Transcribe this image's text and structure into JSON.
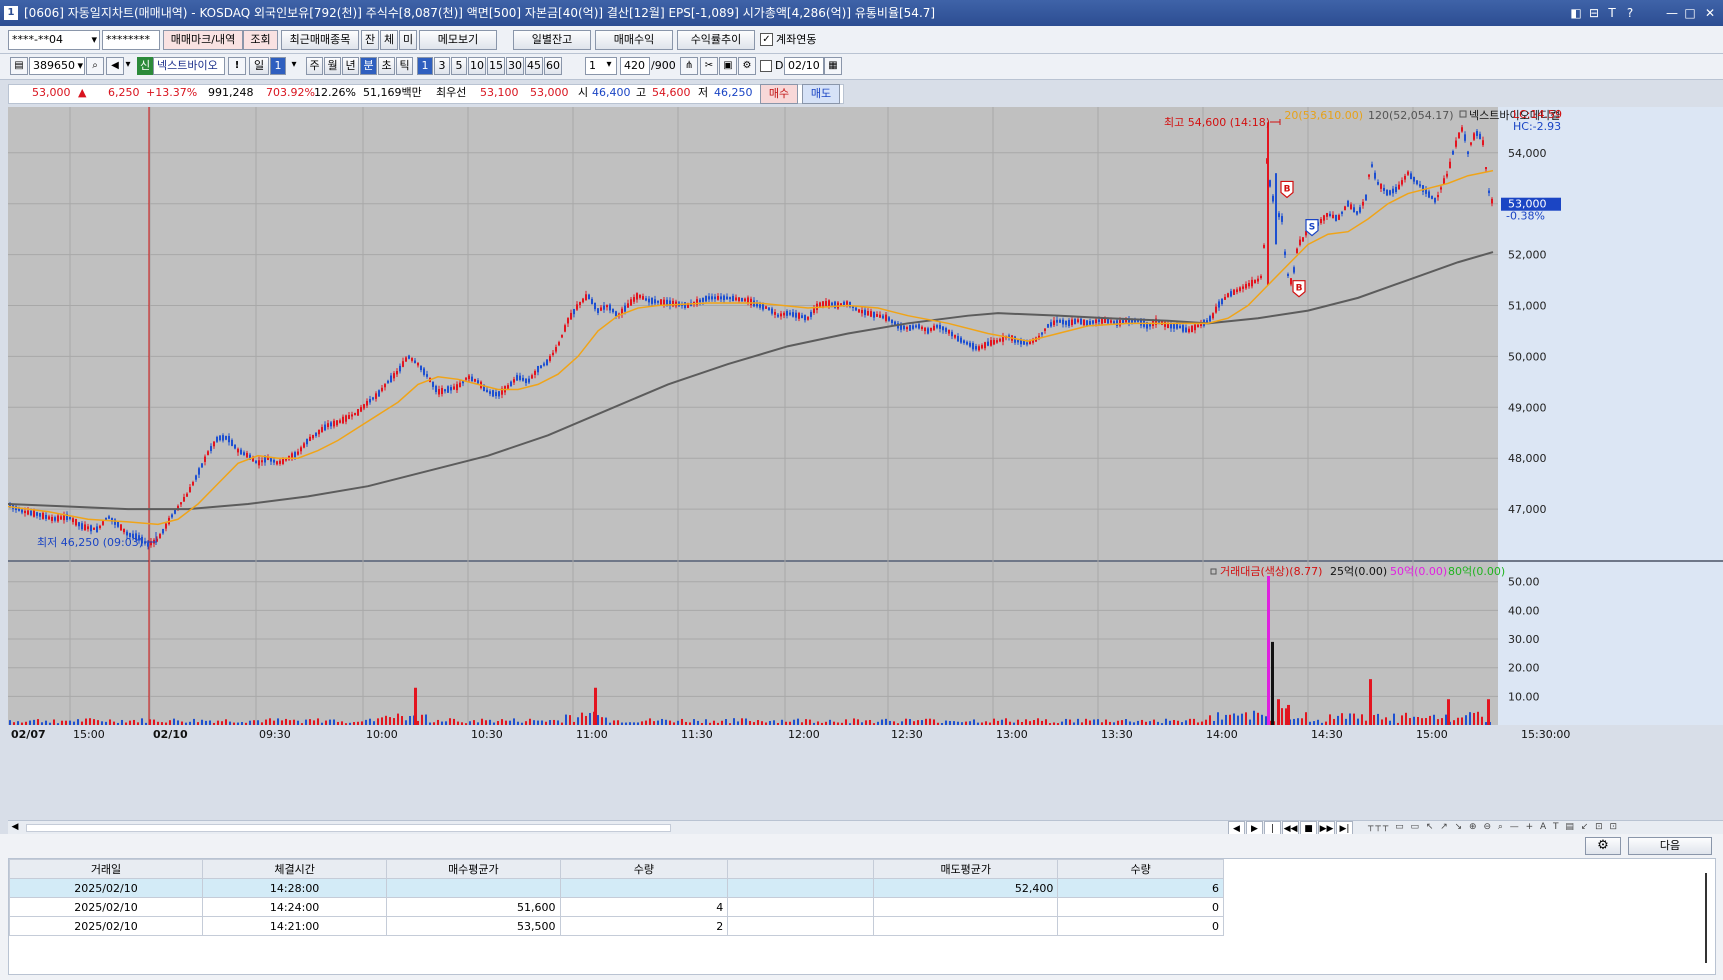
{
  "window": {
    "number": "1",
    "title": "[0606] 자동일지차트(매매내역) - KOSDAQ 외국인보유[792(천)] 주식수[8,087(천)] 액면[500] 자본금[40(억)] 결산[12월] EPS[-1,089] 시가총액[4,286(억)] 유통비율[54.7]",
    "controls": [
      "◧",
      "⊟",
      "T",
      "?",
      "—",
      "□",
      "✕"
    ]
  },
  "toolbar1": {
    "account": "****-**04",
    "password": "********",
    "trade_mark_label": "매매마크/내역",
    "query_label": "조회",
    "recent_label": "최근매매종목",
    "jan_label": "잔",
    "che_label": "체",
    "mi_label": "미",
    "memo_label": "메모보기",
    "daily_balance_label": "일별잔고",
    "trade_profit_label": "매매수익",
    "return_trend_label": "수익률추이",
    "account_link_label": "계좌연동",
    "account_link_checked": true
  },
  "toolbar2": {
    "code": "389650",
    "credit_badge": "신",
    "stock_name": "넥스트바이오",
    "warn_label": "!",
    "day_label": "일",
    "day_value": "1",
    "periods": [
      "주",
      "월",
      "년",
      "분",
      "초",
      "틱"
    ],
    "active_period": "분",
    "minutes": [
      "1",
      "3",
      "5",
      "10",
      "15",
      "30",
      "45",
      "60"
    ],
    "active_minute": "1",
    "step": "1",
    "count": "420",
    "count_total": "/900",
    "d_label": "D",
    "date": "02/10"
  },
  "quote": {
    "price": "53,000",
    "change_arrow": "▲",
    "change": "6,250",
    "change_pct": "+13.37%",
    "volume": "991,248",
    "volume_ratio": "703.92%",
    "turnover": "12.26%",
    "amount": "51,169백만",
    "best_label": "최우선",
    "best_ask": "53,100",
    "best_bid": "53,000",
    "open_label": "시",
    "open": "46,400",
    "high_label": "고",
    "high": "54,600",
    "low_label": "저",
    "low": "46,250",
    "buy_label": "매수",
    "sell_label": "매도"
  },
  "chart_data": {
    "type": "candlestick",
    "ma_legend": {
      "ma20": "20(53,610.00)",
      "ma120": "120(52,054.17)",
      "name": "넥스트바이오메디컬"
    },
    "lc_label": "LC:14.59",
    "hc_label": "HC:-2.93",
    "current_price_label": "53,000",
    "current_change_label": "-0.38%",
    "high_annotation": "최고 54,600 (14:18)",
    "low_annotation": "최저 46,250 (09:03)",
    "y_ticks": [
      "54,000",
      "53,000",
      "52,000",
      "51,000",
      "50,000",
      "49,000",
      "48,000",
      "47,000"
    ],
    "y_range": [
      46000,
      54900
    ],
    "x_ticks": [
      "02/07",
      "15:00",
      "02/10",
      "09:30",
      "10:00",
      "10:30",
      "11:00",
      "11:30",
      "12:00",
      "12:30",
      "13:00",
      "13:30",
      "14:00",
      "14:30",
      "15:00",
      "15:30:00"
    ],
    "price_path": [
      [
        0,
        47100
      ],
      [
        15,
        46950
      ],
      [
        30,
        46900
      ],
      [
        45,
        46800
      ],
      [
        60,
        46850
      ],
      [
        75,
        46650
      ],
      [
        90,
        46600
      ],
      [
        100,
        46850
      ],
      [
        110,
        46700
      ],
      [
        120,
        46500
      ],
      [
        130,
        46450
      ],
      [
        140,
        46300
      ],
      [
        150,
        46400
      ],
      [
        165,
        46900
      ],
      [
        180,
        47300
      ],
      [
        190,
        47700
      ],
      [
        200,
        48100
      ],
      [
        210,
        48400
      ],
      [
        220,
        48400
      ],
      [
        230,
        48150
      ],
      [
        240,
        48050
      ],
      [
        250,
        47900
      ],
      [
        260,
        48000
      ],
      [
        270,
        47900
      ],
      [
        280,
        48000
      ],
      [
        290,
        48100
      ],
      [
        300,
        48350
      ],
      [
        310,
        48500
      ],
      [
        320,
        48650
      ],
      [
        330,
        48700
      ],
      [
        340,
        48800
      ],
      [
        350,
        48900
      ],
      [
        360,
        49100
      ],
      [
        370,
        49250
      ],
      [
        380,
        49500
      ],
      [
        390,
        49700
      ],
      [
        400,
        50000
      ],
      [
        410,
        49850
      ],
      [
        420,
        49600
      ],
      [
        430,
        49300
      ],
      [
        440,
        49350
      ],
      [
        450,
        49400
      ],
      [
        460,
        49600
      ],
      [
        470,
        49500
      ],
      [
        480,
        49300
      ],
      [
        490,
        49250
      ],
      [
        500,
        49400
      ],
      [
        510,
        49600
      ],
      [
        520,
        49500
      ],
      [
        530,
        49750
      ],
      [
        540,
        49900
      ],
      [
        550,
        50200
      ],
      [
        560,
        50700
      ],
      [
        570,
        51000
      ],
      [
        580,
        51200
      ],
      [
        590,
        50900
      ],
      [
        600,
        51000
      ],
      [
        610,
        50800
      ],
      [
        620,
        51000
      ],
      [
        630,
        51200
      ],
      [
        640,
        51100
      ],
      [
        660,
        51050
      ],
      [
        680,
        51000
      ],
      [
        700,
        51150
      ],
      [
        720,
        51150
      ],
      [
        740,
        51100
      ],
      [
        750,
        51000
      ],
      [
        760,
        50950
      ],
      [
        770,
        50800
      ],
      [
        780,
        50850
      ],
      [
        790,
        50800
      ],
      [
        800,
        50750
      ],
      [
        810,
        51000
      ],
      [
        820,
        51050
      ],
      [
        830,
        51000
      ],
      [
        840,
        51050
      ],
      [
        850,
        50900
      ],
      [
        860,
        50850
      ],
      [
        870,
        50800
      ],
      [
        880,
        50750
      ],
      [
        890,
        50600
      ],
      [
        900,
        50550
      ],
      [
        910,
        50600
      ],
      [
        920,
        50500
      ],
      [
        930,
        50600
      ],
      [
        940,
        50500
      ],
      [
        950,
        50350
      ],
      [
        960,
        50250
      ],
      [
        970,
        50150
      ],
      [
        980,
        50250
      ],
      [
        990,
        50300
      ],
      [
        1000,
        50400
      ],
      [
        1010,
        50300
      ],
      [
        1020,
        50250
      ],
      [
        1030,
        50350
      ],
      [
        1040,
        50600
      ],
      [
        1050,
        50700
      ],
      [
        1060,
        50650
      ],
      [
        1070,
        50700
      ],
      [
        1080,
        50650
      ],
      [
        1090,
        50700
      ],
      [
        1100,
        50700
      ],
      [
        1110,
        50650
      ],
      [
        1120,
        50700
      ],
      [
        1130,
        50700
      ],
      [
        1140,
        50600
      ],
      [
        1150,
        50700
      ],
      [
        1160,
        50600
      ],
      [
        1170,
        50600
      ],
      [
        1180,
        50500
      ],
      [
        1190,
        50600
      ],
      [
        1200,
        50700
      ],
      [
        1205,
        50800
      ],
      [
        1210,
        51000
      ],
      [
        1220,
        51200
      ],
      [
        1230,
        51300
      ],
      [
        1240,
        51400
      ],
      [
        1250,
        51500
      ],
      [
        1255,
        51600
      ],
      [
        1260,
        54400
      ],
      [
        1262,
        53400
      ],
      [
        1266,
        53000
      ],
      [
        1270,
        52800
      ],
      [
        1274,
        52700
      ],
      [
        1278,
        51800
      ],
      [
        1282,
        51400
      ],
      [
        1286,
        51700
      ],
      [
        1290,
        52200
      ],
      [
        1295,
        52300
      ],
      [
        1300,
        52500
      ],
      [
        1310,
        52600
      ],
      [
        1320,
        52800
      ],
      [
        1330,
        52700
      ],
      [
        1340,
        53000
      ],
      [
        1350,
        52800
      ],
      [
        1360,
        53200
      ],
      [
        1362,
        53900
      ],
      [
        1366,
        53600
      ],
      [
        1370,
        53400
      ],
      [
        1380,
        53200
      ],
      [
        1390,
        53300
      ],
      [
        1400,
        53600
      ],
      [
        1410,
        53400
      ],
      [
        1420,
        53200
      ],
      [
        1428,
        53050
      ],
      [
        1435,
        53400
      ],
      [
        1440,
        53600
      ],
      [
        1445,
        54000
      ],
      [
        1450,
        54300
      ],
      [
        1455,
        54500
      ],
      [
        1460,
        54000
      ],
      [
        1465,
        54300
      ],
      [
        1470,
        54400
      ],
      [
        1475,
        54200
      ],
      [
        1478,
        53700
      ],
      [
        1480,
        53300
      ],
      [
        1483,
        53100
      ],
      [
        1485,
        53000
      ]
    ],
    "ma20_path": [
      [
        0,
        47050
      ],
      [
        40,
        46950
      ],
      [
        80,
        46800
      ],
      [
        120,
        46750
      ],
      [
        150,
        46700
      ],
      [
        170,
        46800
      ],
      [
        190,
        47100
      ],
      [
        210,
        47500
      ],
      [
        230,
        47900
      ],
      [
        250,
        48050
      ],
      [
        270,
        48000
      ],
      [
        290,
        48000
      ],
      [
        310,
        48150
      ],
      [
        330,
        48350
      ],
      [
        350,
        48600
      ],
      [
        370,
        48850
      ],
      [
        390,
        49100
      ],
      [
        410,
        49450
      ],
      [
        430,
        49600
      ],
      [
        450,
        49550
      ],
      [
        470,
        49450
      ],
      [
        490,
        49350
      ],
      [
        510,
        49350
      ],
      [
        530,
        49450
      ],
      [
        550,
        49650
      ],
      [
        570,
        50000
      ],
      [
        590,
        50500
      ],
      [
        610,
        50800
      ],
      [
        630,
        50950
      ],
      [
        650,
        51000
      ],
      [
        700,
        51050
      ],
      [
        750,
        51050
      ],
      [
        800,
        50950
      ],
      [
        840,
        51000
      ],
      [
        870,
        50950
      ],
      [
        900,
        50800
      ],
      [
        940,
        50650
      ],
      [
        980,
        50450
      ],
      [
        1020,
        50300
      ],
      [
        1050,
        50450
      ],
      [
        1080,
        50600
      ],
      [
        1120,
        50650
      ],
      [
        1160,
        50650
      ],
      [
        1200,
        50650
      ],
      [
        1220,
        50750
      ],
      [
        1240,
        51000
      ],
      [
        1260,
        51400
      ],
      [
        1280,
        51800
      ],
      [
        1300,
        52200
      ],
      [
        1320,
        52400
      ],
      [
        1340,
        52450
      ],
      [
        1360,
        52700
      ],
      [
        1380,
        53000
      ],
      [
        1400,
        53200
      ],
      [
        1420,
        53300
      ],
      [
        1440,
        53400
      ],
      [
        1460,
        53550
      ],
      [
        1485,
        53650
      ]
    ],
    "ma120_path": [
      [
        0,
        47100
      ],
      [
        60,
        47050
      ],
      [
        120,
        47000
      ],
      [
        180,
        47000
      ],
      [
        240,
        47100
      ],
      [
        300,
        47250
      ],
      [
        360,
        47450
      ],
      [
        420,
        47750
      ],
      [
        480,
        48050
      ],
      [
        540,
        48450
      ],
      [
        600,
        48950
      ],
      [
        660,
        49450
      ],
      [
        720,
        49850
      ],
      [
        780,
        50200
      ],
      [
        840,
        50450
      ],
      [
        900,
        50650
      ],
      [
        960,
        50800
      ],
      [
        990,
        50850
      ],
      [
        1050,
        50800
      ],
      [
        1100,
        50750
      ],
      [
        1160,
        50700
      ],
      [
        1200,
        50650
      ],
      [
        1250,
        50750
      ],
      [
        1300,
        50900
      ],
      [
        1350,
        51150
      ],
      [
        1400,
        51500
      ],
      [
        1450,
        51850
      ],
      [
        1485,
        52050
      ]
    ],
    "trade_marks": [
      {
        "label": "B",
        "x": 1279,
        "price": 53300
      },
      {
        "label": "S",
        "x": 1304,
        "price": 52550
      },
      {
        "label": "B",
        "x": 1291,
        "price": 51350
      }
    ],
    "volume_legend": {
      "main": "거래대금(색상)(8.77)",
      "l25": "25억(0.00)",
      "l50": "50억(0.00)",
      "l80": "80억(0.00)"
    },
    "volume_ticks": [
      "50.00",
      "40.00",
      "30.00",
      "20.00",
      "10.00"
    ],
    "volume_range": [
      0,
      52
    ],
    "volume_spikes": [
      [
        407,
        13
      ],
      [
        587,
        13
      ],
      [
        1260,
        52
      ],
      [
        1264,
        29
      ],
      [
        1270,
        9
      ],
      [
        1280,
        7
      ],
      [
        1362,
        16
      ],
      [
        1440,
        9
      ],
      [
        1480,
        9
      ]
    ]
  },
  "nav_buttons": [
    "◀",
    "▶",
    "|◀◀",
    "◀◀",
    "■",
    "▶▶",
    "▶|"
  ],
  "panel": {
    "settings_icon": "gear-icon",
    "next_label": "다음",
    "columns": [
      "거래일",
      "체결시간",
      "매수평균가",
      "수량",
      "",
      "매도평균가",
      "수량"
    ],
    "rows": [
      [
        "2025/02/10",
        "14:28:00",
        "",
        "",
        "",
        "52,400",
        "6"
      ],
      [
        "2025/02/10",
        "14:24:00",
        "51,600",
        "4",
        "",
        "",
        "0"
      ],
      [
        "2025/02/10",
        "14:21:00",
        "53,500",
        "2",
        "",
        "",
        "0"
      ]
    ]
  }
}
